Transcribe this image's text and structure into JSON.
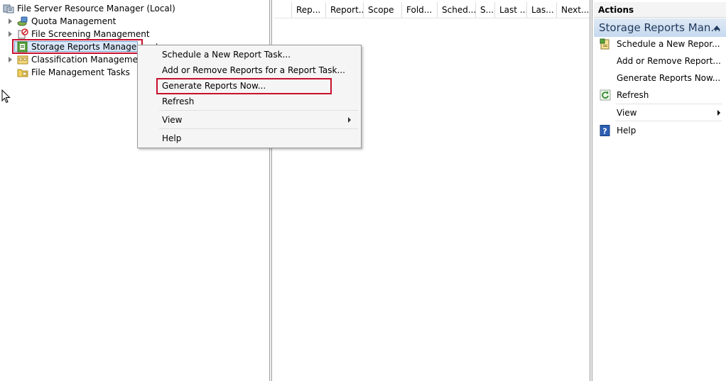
{
  "tree": {
    "root": "File Server Resource Manager (Local)",
    "items": [
      {
        "label": "Quota Management",
        "icon": "quota-icon"
      },
      {
        "label": "File Screening Management",
        "icon": "file-screen-icon"
      },
      {
        "label": "Storage Reports Management",
        "icon": "storage-reports-icon",
        "selected": true
      },
      {
        "label": "Classification Management",
        "icon": "classification-icon"
      },
      {
        "label": "File Management Tasks",
        "icon": "file-tasks-icon"
      }
    ]
  },
  "list": {
    "columns": [
      "Rep...",
      "Report...",
      "Scope",
      "Fold...",
      "Sched...",
      "S...",
      "Last ...",
      "Las...",
      "Next..."
    ]
  },
  "context_menu": {
    "items": [
      {
        "label": "Schedule a New Report Task..."
      },
      {
        "label": "Add or Remove Reports for a Report Task..."
      },
      {
        "label": "Generate Reports Now...",
        "highlighted": true
      },
      {
        "label": "Refresh"
      },
      {
        "label": "View",
        "submenu": true
      },
      {
        "label": "Help"
      }
    ]
  },
  "actions": {
    "title": "Actions",
    "section": "Storage Reports Man...",
    "items": [
      {
        "label": "Schedule a New Repor...",
        "icon": "schedule-icon"
      },
      {
        "label": "Add or Remove Report..."
      },
      {
        "label": "Generate Reports Now..."
      },
      {
        "label": "Refresh",
        "icon": "refresh-icon"
      },
      {
        "label": "View",
        "submenu": true
      },
      {
        "label": "Help",
        "icon": "help-icon"
      }
    ]
  },
  "colors": {
    "highlight_border": "#c8102e",
    "section_header": "#c6d9ef",
    "selection": "#d9e8fa"
  }
}
